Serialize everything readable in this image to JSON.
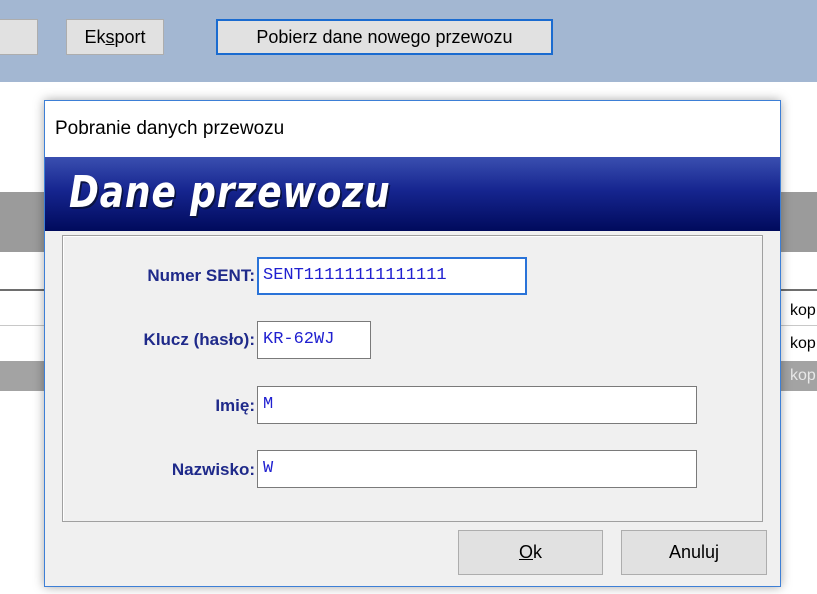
{
  "toolbar": {
    "export_label_pre": "Ek",
    "export_label_accel": "s",
    "export_label_post": "port",
    "fetch_label": "Pobierz dane nowego przewozu"
  },
  "background_rows": [
    {
      "text": "kop"
    },
    {
      "text": "kop"
    },
    {
      "text": "kop"
    }
  ],
  "dialog": {
    "title": "Pobranie danych przewozu",
    "banner": "Dane przewozu",
    "fields": {
      "numer_label": "Numer SENT:",
      "numer_value": "SENT11111111111111",
      "klucz_label": "Klucz (hasło):",
      "klucz_value": "KR-62WJ",
      "imie_label": "Imię:",
      "imie_value": "M",
      "nazwisko_label": "Nazwisko:",
      "nazwisko_value": "W"
    },
    "ok_accel": "O",
    "ok_rest": "k",
    "cancel_label": "Anuluj"
  },
  "colors": {
    "toolbar_bg": "#a3b7d2",
    "label_text": "#1f2a8a",
    "field_text": "#2020d0",
    "focus_border": "#2a73d8",
    "banner_dark": "#000a5c"
  }
}
